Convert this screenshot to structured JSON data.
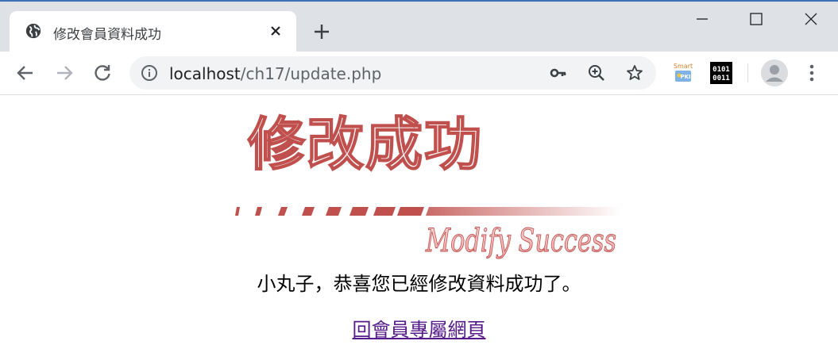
{
  "tab": {
    "title": "修改會員資料成功"
  },
  "omnibox": {
    "host": "localhost",
    "path": "/ch17/update.php"
  },
  "extensions": {
    "smartpki_line1": "Smart",
    "smartpki_line2": "PKI",
    "binary_line1": "0101",
    "binary_line2": "0011"
  },
  "page": {
    "banner_title": "修改成功",
    "banner_subtitle": "Modify Success",
    "message": "小丸子，恭喜您已經修改資料成功了。",
    "return_link": "回會員專屬網頁"
  },
  "colors": {
    "tabstrip_bg": "#dee1e6",
    "omnibox_bg": "#f1f3f4",
    "banner_red": "#c0504d",
    "visited_link": "#551a8b"
  }
}
